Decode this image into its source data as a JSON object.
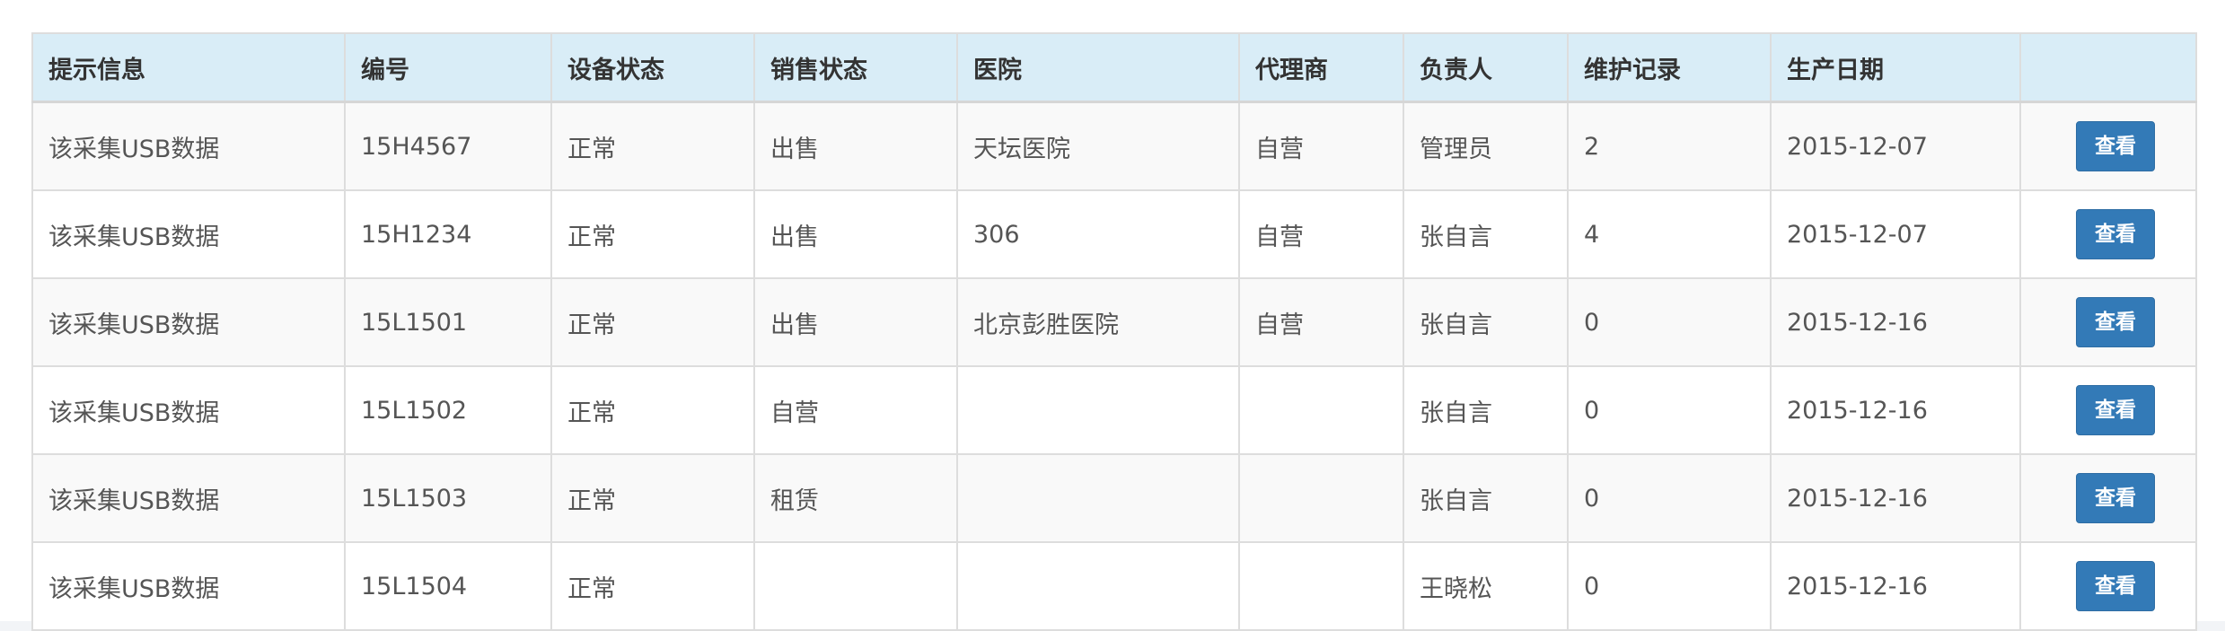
{
  "table": {
    "headers": [
      "提示信息",
      "编号",
      "设备状态",
      "销售状态",
      "医院",
      "代理商",
      "负责人",
      "维护记录",
      "生产日期",
      ""
    ],
    "rows": [
      {
        "hint": "该采集USB数据",
        "code": "15H4567",
        "device_status": "正常",
        "sale_status": "出售",
        "hospital": "天坛医院",
        "agent": "自营",
        "owner": "管理员",
        "maintenance": "2",
        "production_date": "2015-12-07",
        "action_label": "查看"
      },
      {
        "hint": "该采集USB数据",
        "code": "15H1234",
        "device_status": "正常",
        "sale_status": "出售",
        "hospital": "306",
        "agent": "自营",
        "owner": "张自言",
        "maintenance": "4",
        "production_date": "2015-12-07",
        "action_label": "查看"
      },
      {
        "hint": "该采集USB数据",
        "code": "15L1501",
        "device_status": "正常",
        "sale_status": "出售",
        "hospital": "北京彭胜医院",
        "agent": "自营",
        "owner": "张自言",
        "maintenance": "0",
        "production_date": "2015-12-16",
        "action_label": "查看"
      },
      {
        "hint": "该采集USB数据",
        "code": "15L1502",
        "device_status": "正常",
        "sale_status": "自营",
        "hospital": "",
        "agent": "",
        "owner": "张自言",
        "maintenance": "0",
        "production_date": "2015-12-16",
        "action_label": "查看"
      },
      {
        "hint": "该采集USB数据",
        "code": "15L1503",
        "device_status": "正常",
        "sale_status": "租赁",
        "hospital": "",
        "agent": "",
        "owner": "张自言",
        "maintenance": "0",
        "production_date": "2015-12-16",
        "action_label": "查看"
      },
      {
        "hint": "该采集USB数据",
        "code": "15L1504",
        "device_status": "正常",
        "sale_status": "",
        "hospital": "",
        "agent": "",
        "owner": "王晓松",
        "maintenance": "0",
        "production_date": "2015-12-16",
        "action_label": "查看"
      }
    ]
  },
  "colors": {
    "header_bg": "#d9edf7",
    "stripe_bg": "#f9f9f9",
    "button_bg": "#337ab7",
    "border": "#dddddd"
  }
}
